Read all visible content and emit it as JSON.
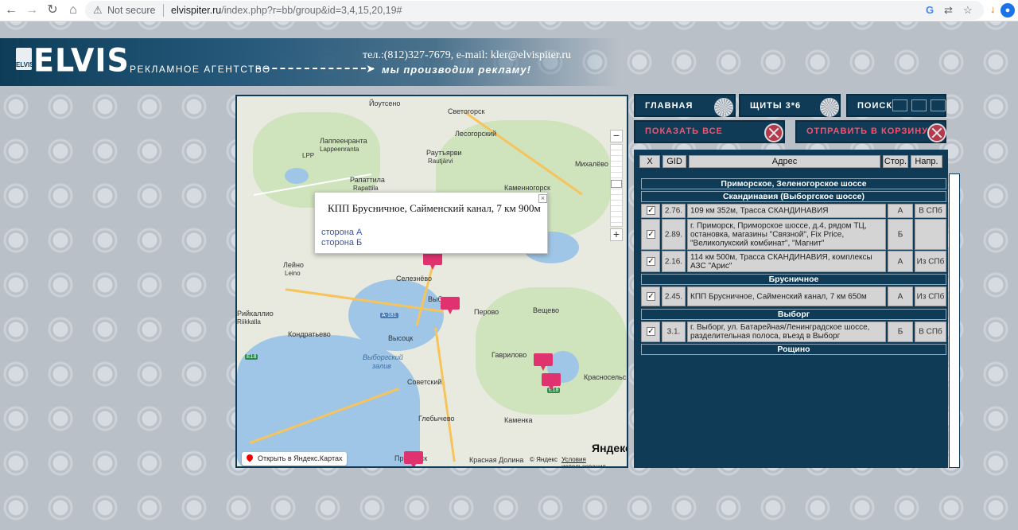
{
  "browser": {
    "secure_label": "Not secure",
    "url_host": "elvispiter.ru",
    "url_rest": "/index.php?r=bb/group&id=3,4,15,20,19#"
  },
  "header": {
    "logo_mark": "ELVIS",
    "logo_text": "ELVIS",
    "agency": "РЕКЛАМНОЕ АГЕНТСТВО",
    "contacts": "тел.:(812)327-7679, e-mail: kler@elvispiter.ru",
    "slogan": "мы производим рекламу!"
  },
  "nav": {
    "home": "ГЛАВНАЯ",
    "boards": "ЩИТЫ 3*6",
    "search": "ПОИСК",
    "show_all": "ПОКАЗАТЬ ВСЕ",
    "send_cart": "ОТПРАВИТЬ В КОРЗИНУ"
  },
  "map": {
    "popup_title": "КПП Брусничное, Сайменский канал, 7 км 900м",
    "popup_sides": [
      "сторона А",
      "сторона Б"
    ],
    "open_in_yandex": "Открыть в Яндекс.Картах",
    "logo": "Яндекс",
    "copyright": "© Яндекс",
    "terms": "Условия использования",
    "labels": {
      "l1": "Йоутсено",
      "l2": "Светогорск",
      "l3": "Лесогорский",
      "l4": "Лаппеенранта",
      "l5": "Lappeenranta",
      "l6": "LPP",
      "l7": "Раутъярви",
      "l8": "Rautjärvi",
      "l9": "Михалёво",
      "l10": "Каменногорск",
      "l11": "Рапаттила",
      "l12": "Rapattila",
      "l13": "Лейно",
      "l14": "Leino",
      "l15": "Селезнёво",
      "l16": "Перово",
      "l17": "Вещево",
      "l18": "Выборг",
      "l19": "Высоцк",
      "l20": "Кондратьево",
      "l21": "Выборгский",
      "l22": "залив",
      "l23": "Гаврилово",
      "l24": "Советский",
      "l25": "Глебычево",
      "l26": "Каменка",
      "l27": "Красносельское",
      "l28": "Красная Долина",
      "l29": "Приморск",
      "l30": "Рийкаллио",
      "l31": "Riikkalla"
    },
    "shields": {
      "s1": "A-181",
      "s2": "E18",
      "s3": "E18",
      "s4": "А-181"
    }
  },
  "table": {
    "headers": {
      "x": "X",
      "gid": "GID",
      "address": "Адрес",
      "side": "Стор.",
      "dir": "Напр."
    },
    "groups": {
      "g1": "Приморское, Зеленогорское шоссе",
      "g2": "Скандинавия (Выборгское шоссе)",
      "g3": "Брусничное",
      "g4": "Выборг",
      "g5": "Рощино"
    },
    "rows": [
      {
        "check": "✓",
        "gid": "2.76.",
        "address": "109 км 352м, Трасса СКАНДИНАВИЯ",
        "side": "А",
        "dir": "В СПб"
      },
      {
        "check": "✓",
        "gid": "2.89.",
        "address": "г. Приморск, Приморское шоссе, д.4, рядом ТЦ, остановка, магазины \"Связной\", Fix Price, \"Великолукский комбинат\", \"Магнит\"",
        "side": "Б",
        "dir": ""
      },
      {
        "check": "✓",
        "gid": "2.16.",
        "address": "114 км 500м, Трасса СКАНДИНАВИЯ, комплексы АЗС \"Арис\"",
        "side": "А",
        "dir": "Из СПб"
      },
      {
        "check": "✓",
        "gid": "2.45.",
        "address": "КПП Брусничное, Сайменский канал, 7 км 650м",
        "side": "А",
        "dir": "Из СПб"
      },
      {
        "check": "✓",
        "gid": "3.1.",
        "address": "г. Выборг, ул. Батарейная/Ленинградское шоссе, разделительная полоса, въезд в Выборг",
        "side": "Б",
        "dir": "В СПб"
      }
    ]
  }
}
